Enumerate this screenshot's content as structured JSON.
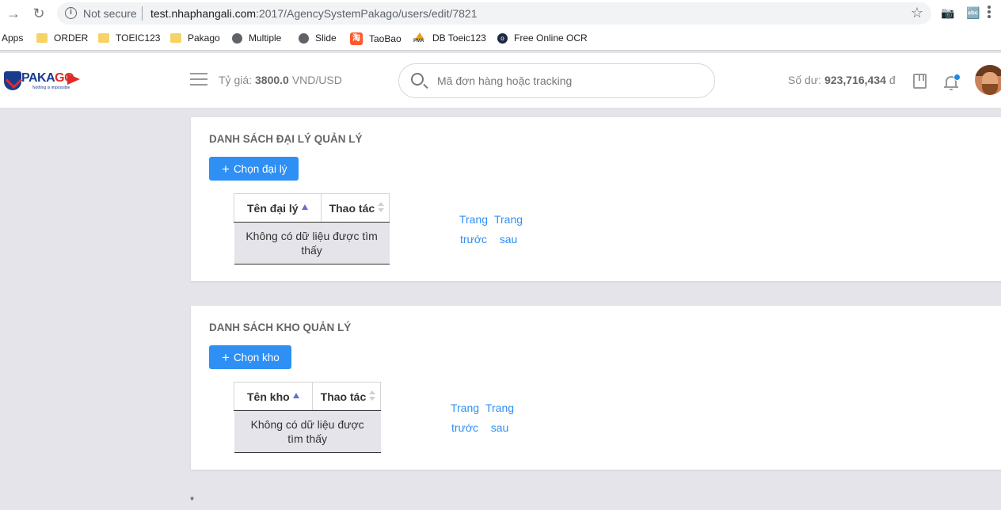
{
  "browser": {
    "security_label": "Not secure",
    "url_host": "test.nhaphangali.com",
    "url_path": ":2017/AgencySystemPakago/users/edit/7821",
    "bookmarks": [
      {
        "label": "Apps",
        "icon": "apps-grid-icon"
      },
      {
        "label": "ORDER",
        "icon": "folder-icon"
      },
      {
        "label": "TOEIC123",
        "icon": "folder-icon"
      },
      {
        "label": "Pakago",
        "icon": "folder-icon"
      },
      {
        "label": "Multiple",
        "icon": "globe-icon"
      },
      {
        "label": "Slide",
        "icon": "globe-icon"
      },
      {
        "label": "TaoBao",
        "icon": "taobao-icon"
      },
      {
        "label": "DB Toeic123",
        "icon": "pma-icon"
      },
      {
        "label": "Free Online OCR",
        "icon": "ocr-icon"
      }
    ]
  },
  "header": {
    "logo_text_a": "PAKA",
    "logo_text_b": "GO",
    "logo_tagline": "Nothing is impossible",
    "rate_label": "Tỷ giá:",
    "rate_value": "3800.0",
    "rate_unit": "VND/USD",
    "search_placeholder": "Mã đơn hàng hoặc tracking",
    "balance_label": "Số dư:",
    "balance_value": "923,716,434",
    "balance_unit": "đ"
  },
  "agency_section": {
    "title": "DANH SÁCH ĐẠI LÝ QUẢN LÝ",
    "add_button": "Chọn đại lý",
    "col_name": "Tên đại lý",
    "col_actions": "Thao tác",
    "empty_text": "Không có dữ liệu được tìm thấy",
    "prev_label": "Trang trước",
    "next_label": "Trang sau"
  },
  "warehouse_section": {
    "title": "DANH SÁCH KHO QUẢN LÝ",
    "add_button": "Chọn kho",
    "col_name": "Tên kho",
    "col_actions": "Thao tác",
    "empty_text": "Không có dữ liệu được tìm thấy",
    "prev_label": "Trang trước",
    "next_label": "Trang sau"
  },
  "footer": {
    "asterisk": "*"
  },
  "colors": {
    "primary": "#2e8ff5",
    "page_bg": "#e4e4ea",
    "brand_blue": "#1a3c8f",
    "brand_red": "#e02a2a"
  }
}
